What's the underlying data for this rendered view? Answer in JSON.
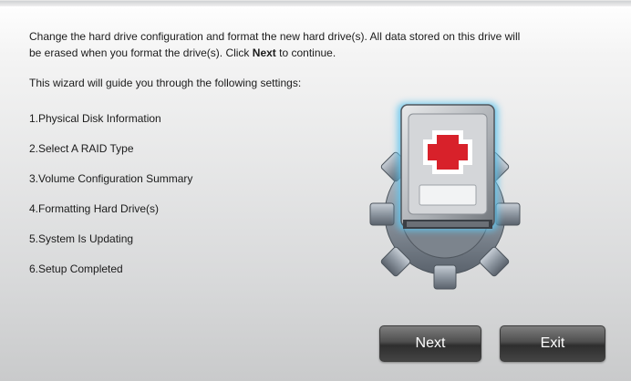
{
  "intro": {
    "line1_before": "Change the hard drive configuration and format the new hard drive(s). All data stored on this drive will",
    "line2_before": "be erased when you format the drive(s). Click ",
    "next_word": "Next",
    "line2_after": " to continue."
  },
  "guide_text": "This wizard will guide you through the following settings:",
  "steps": [
    "1.Physical Disk Information",
    "2.Select A RAID Type",
    "3.Volume Configuration Summary",
    "4.Formatting Hard Drive(s)",
    "5.System Is Updating",
    "6.Setup Completed"
  ],
  "buttons": {
    "next": "Next",
    "exit": "Exit"
  },
  "icons": {
    "wizard_art": "hard-drive-gear-medical-cross-icon"
  },
  "colors": {
    "cross": "#d8212a",
    "glow": "#5fc4ee"
  }
}
